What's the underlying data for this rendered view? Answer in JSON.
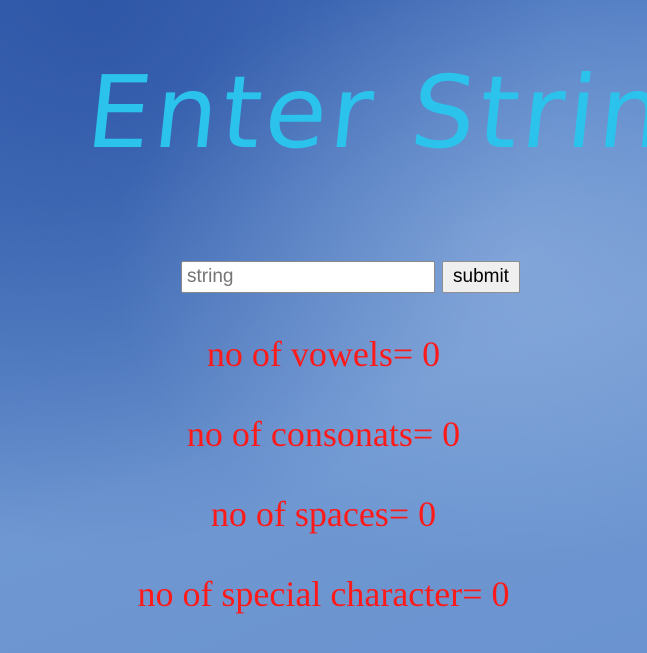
{
  "page": {
    "title": "Enter String"
  },
  "form": {
    "input_placeholder": "string",
    "input_value": "",
    "submit_label": "submit"
  },
  "results": {
    "vowels": "no of vowels= 0",
    "consonants": "no of consonats= 0",
    "spaces": "no of spaces= 0",
    "special": "no of special character= 0"
  },
  "colors": {
    "title": "#2bc3ec",
    "result_text": "#ff1a1a",
    "background": "#5a86c8"
  }
}
